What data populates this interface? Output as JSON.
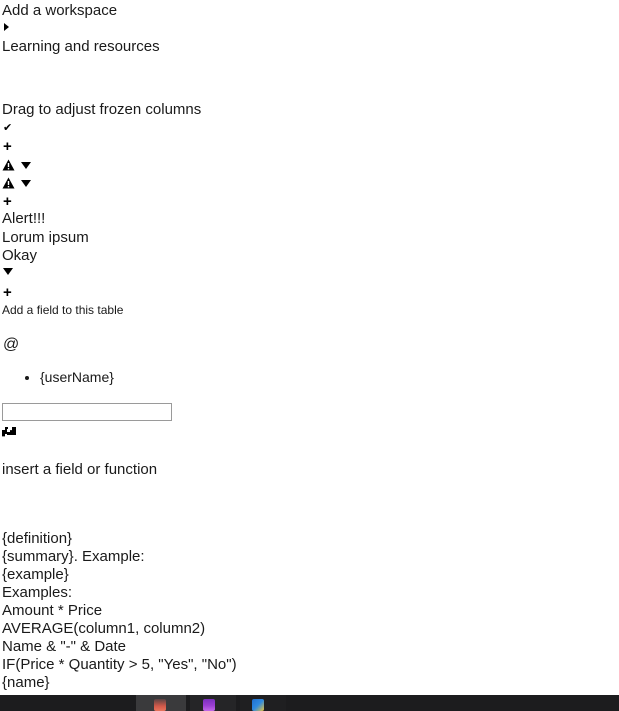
{
  "page": {
    "background_color": "#ffffff",
    "text_color": "#1a1a1a"
  },
  "workspace": {
    "add_workspace_label": "Add a workspace",
    "expand_caret_icon": "caret-right-icon",
    "learning_resources_label": "Learning and resources"
  },
  "grid": {
    "frozen_columns_hint": "Drag to adjust frozen columns",
    "check_glyph": "✔",
    "add_row_glyph": "+",
    "add_field_glyph": "+",
    "add_field_label": "Add a field to this table"
  },
  "alerts": [
    {
      "icon": "warning-triangle-icon",
      "caret": "caret-down-icon"
    },
    {
      "icon": "warning-triangle-icon",
      "caret": "caret-down-icon"
    }
  ],
  "dialog": {
    "title": "Alert!!!",
    "body": "Lorum ipsum",
    "confirm_label": "Okay",
    "caret_icon": "caret-down-icon"
  },
  "mention": {
    "at_symbol": "@",
    "options": [
      {
        "label": "{userName}"
      }
    ]
  },
  "formula": {
    "input_value": "",
    "input_placeholder": "",
    "enter_key_icon": "enter-key-icon",
    "insert_hint": "insert a field or function",
    "definition": "{definition}",
    "summary_line": "{summary}. Example:",
    "example": "{example}",
    "examples_label": "Examples:",
    "examples": [
      "Amount * Price",
      "AVERAGE(column1, column2)",
      "Name & \"-\" & Date",
      "IF(Price * Quantity > 5, \"Yes\", \"No\")"
    ],
    "name_token": "{name}"
  },
  "taskbar": {
    "background_color": "#1c1c1e",
    "items": [
      {
        "name": "app-icon-terminal",
        "color": "#d4594a"
      },
      {
        "name": "app-icon-editor",
        "color": "#9b3fd4"
      },
      {
        "name": "app-icon-browser",
        "color": "#2f8ae0"
      }
    ]
  }
}
